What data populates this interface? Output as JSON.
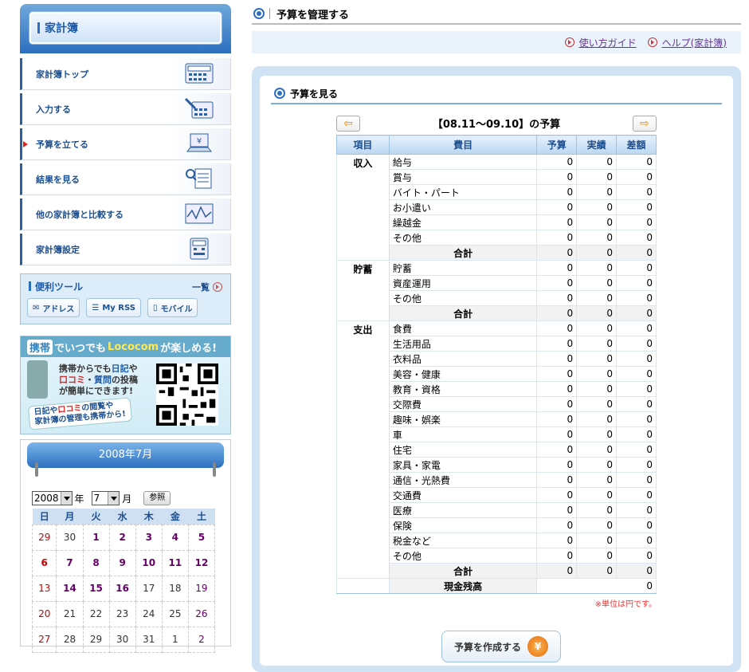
{
  "sidebar": {
    "title": "家計簿",
    "menu": [
      {
        "label": "家計簿トップ",
        "icon": "calculator-icon"
      },
      {
        "label": "入力する",
        "icon": "pen-calculator-icon"
      },
      {
        "label": "予算を立てる",
        "icon": "laptop-yen-icon"
      },
      {
        "label": "結果を見る",
        "icon": "magnifier-document-icon"
      },
      {
        "label": "他の家計簿と比較する",
        "icon": "chart-icon"
      },
      {
        "label": "家計簿設定",
        "icon": "settings-panel-icon"
      }
    ],
    "tools": {
      "title": "便利ツール",
      "more": "一覧",
      "buttons": [
        {
          "label": "アドレス",
          "icon": "address-icon"
        },
        {
          "label": "My RSS",
          "icon": "rss-icon"
        },
        {
          "label": "モバイル",
          "icon": "mobile-icon"
        }
      ]
    },
    "banner": {
      "brand": "携帯",
      "headline_a": "でいつでも",
      "headline_b": "Lococom",
      "headline_c": "が楽しめる!",
      "line1a": "携帯からでも",
      "line1b": "日記",
      "line1c": "や",
      "line2a": "口コミ",
      "line2b": "・",
      "line2c": "質問",
      "line2d": "の投稿",
      "line3": "が簡単にできます!",
      "sub1a": "日記",
      "sub1b": "や",
      "sub1c": "口コミ",
      "sub1d": "の閲覧や",
      "sub2": "家計簿の管理も携帯から!"
    },
    "calendar": {
      "title": "2008年7月",
      "year": "2008",
      "year_unit": "年",
      "month": "7",
      "month_unit": "月",
      "ref_button": "参照",
      "weekdays": [
        "日",
        "月",
        "火",
        "水",
        "木",
        "金",
        "土"
      ],
      "weeks": [
        [
          "29",
          "30",
          "1",
          "2",
          "3",
          "4",
          "5"
        ],
        [
          "6",
          "7",
          "8",
          "9",
          "10",
          "11",
          "12"
        ],
        [
          "13",
          "14",
          "15",
          "16",
          "17",
          "18",
          "19"
        ],
        [
          "20",
          "21",
          "22",
          "23",
          "24",
          "25",
          "26"
        ],
        [
          "27",
          "28",
          "29",
          "30",
          "31",
          "1",
          "2"
        ]
      ]
    }
  },
  "main": {
    "page_title": "予算を管理する",
    "links": {
      "guide": "使い方ガイド",
      "help": "ヘルプ(家計簿)"
    },
    "section_title": "予算を見る",
    "period_title": "【08.11～09.10】の予算",
    "columns": [
      "項目",
      "費目",
      "予算",
      "実績",
      "差額"
    ],
    "groups": [
      {
        "name": "収入",
        "items": [
          "給与",
          "賞与",
          "バイト・パート",
          "お小遣い",
          "繰越金",
          "その他"
        ]
      },
      {
        "name": "貯蓄",
        "items": [
          "貯蓄",
          "資産運用",
          "その他"
        ]
      },
      {
        "name": "支出",
        "items": [
          "食費",
          "生活用品",
          "衣料品",
          "美容・健康",
          "教育・資格",
          "交際費",
          "趣味・娯楽",
          "車",
          "住宅",
          "家具・家電",
          "通信・光熱費",
          "交通費",
          "医療",
          "保険",
          "税金など",
          "その他"
        ]
      }
    ],
    "subtotal_label": "合計",
    "zero": "0",
    "balance_label": "現金残高",
    "balance_value": "0",
    "unit_note": "※単位は円です。",
    "create_button": "予算を作成する"
  }
}
